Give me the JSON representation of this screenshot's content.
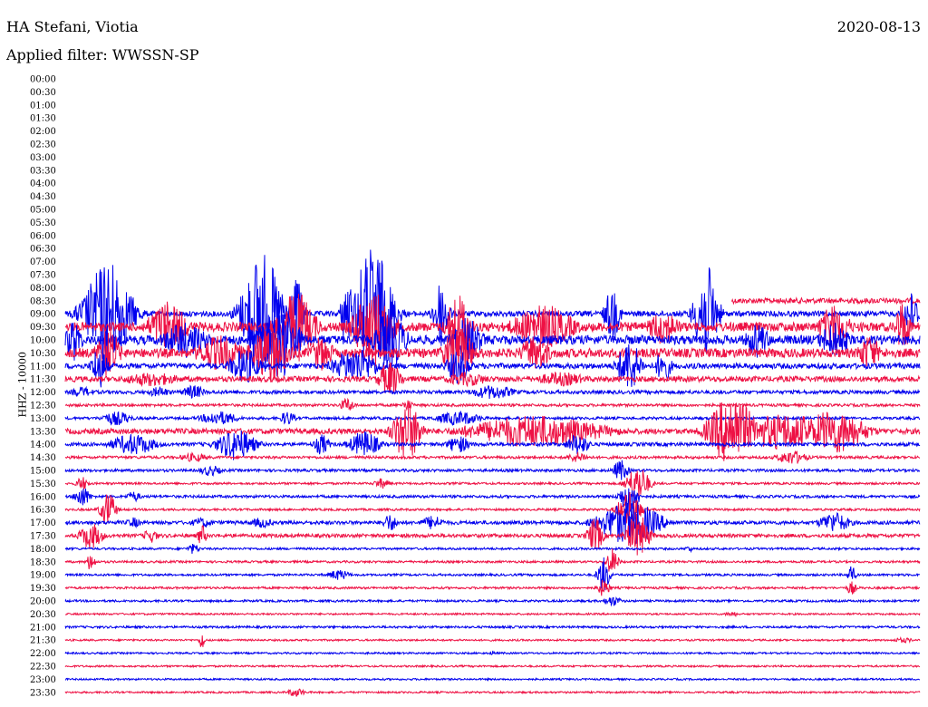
{
  "header": {
    "station": "HA Stefani, Viotia",
    "filter": "Applied filter: WWSSN-SP",
    "date": "2020-08-13"
  },
  "chart_data": {
    "type": "line",
    "title": "HA Stefani, Viotia",
    "subtitle": "Applied filter: WWSSN-SP",
    "date": "2020-08-13",
    "ylabel": "HHZ - 10000",
    "trace_colors": [
      "#0000ee",
      "#ee1144"
    ],
    "rows": [
      {
        "label": "00:00",
        "active": false
      },
      {
        "label": "00:30",
        "active": false
      },
      {
        "label": "01:00",
        "active": false
      },
      {
        "label": "01:30",
        "active": false
      },
      {
        "label": "02:00",
        "active": false
      },
      {
        "label": "02:30",
        "active": false
      },
      {
        "label": "03:00",
        "active": false
      },
      {
        "label": "03:30",
        "active": false
      },
      {
        "label": "04:00",
        "active": false
      },
      {
        "label": "04:30",
        "active": false
      },
      {
        "label": "05:00",
        "active": false
      },
      {
        "label": "05:30",
        "active": false
      },
      {
        "label": "06:00",
        "active": false
      },
      {
        "label": "06:30",
        "active": false
      },
      {
        "label": "07:00",
        "active": false
      },
      {
        "label": "07:30",
        "active": false
      },
      {
        "label": "08:00",
        "active": false
      },
      {
        "label": "08:30",
        "active": true,
        "start": 0.78,
        "noise": 3,
        "events": []
      },
      {
        "label": "09:00",
        "active": true,
        "start": 0,
        "noise": 3,
        "events": [
          [
            0.05,
            30,
            60
          ],
          [
            0.23,
            25,
            70
          ],
          [
            0.27,
            10,
            40
          ],
          [
            0.33,
            8,
            40
          ],
          [
            0.36,
            25,
            75
          ],
          [
            0.44,
            10,
            40
          ],
          [
            0.64,
            10,
            30
          ],
          [
            0.75,
            15,
            55
          ],
          [
            0.99,
            10,
            25
          ]
        ]
      },
      {
        "label": "09:30",
        "active": true,
        "start": 0,
        "noise": 5,
        "events": [
          [
            0.12,
            25,
            30
          ],
          [
            0.27,
            25,
            40
          ],
          [
            0.36,
            25,
            45
          ],
          [
            0.46,
            15,
            40
          ],
          [
            0.56,
            40,
            25
          ],
          [
            0.7,
            20,
            20
          ],
          [
            0.9,
            20,
            25
          ],
          [
            0.98,
            10,
            30
          ]
        ]
      },
      {
        "label": "10:00",
        "active": true,
        "start": 0,
        "noise": 5,
        "events": [
          [
            0.01,
            10,
            25
          ],
          [
            0.14,
            30,
            20
          ],
          [
            0.25,
            25,
            45
          ],
          [
            0.38,
            20,
            35
          ],
          [
            0.47,
            20,
            25
          ],
          [
            0.81,
            15,
            20
          ],
          [
            0.9,
            20,
            20
          ]
        ]
      },
      {
        "label": "10:30",
        "active": true,
        "start": 0,
        "noise": 5,
        "events": [
          [
            0.05,
            15,
            30
          ],
          [
            0.18,
            30,
            20
          ],
          [
            0.24,
            25,
            35
          ],
          [
            0.3,
            15,
            20
          ],
          [
            0.46,
            20,
            30
          ],
          [
            0.55,
            20,
            20
          ],
          [
            0.94,
            15,
            20
          ]
        ]
      },
      {
        "label": "11:00",
        "active": true,
        "start": 0,
        "noise": 3,
        "events": [
          [
            0.04,
            10,
            25
          ],
          [
            0.21,
            20,
            20
          ],
          [
            0.34,
            30,
            20
          ],
          [
            0.46,
            15,
            20
          ],
          [
            0.66,
            15,
            30
          ],
          [
            0.7,
            10,
            20
          ]
        ]
      },
      {
        "label": "11:30",
        "active": true,
        "start": 0,
        "noise": 3,
        "events": [
          [
            0.1,
            40,
            8
          ],
          [
            0.38,
            15,
            20
          ],
          [
            0.47,
            30,
            8
          ],
          [
            0.58,
            35,
            8
          ]
        ]
      },
      {
        "label": "12:00",
        "active": true,
        "start": 0,
        "noise": 2,
        "events": [
          [
            0.02,
            15,
            6
          ],
          [
            0.11,
            15,
            6
          ],
          [
            0.15,
            15,
            8
          ],
          [
            0.5,
            30,
            8
          ]
        ]
      },
      {
        "label": "12:30",
        "active": true,
        "start": 0,
        "noise": 1.5,
        "events": [
          [
            0.33,
            10,
            8
          ],
          [
            0.4,
            8,
            6
          ]
        ]
      },
      {
        "label": "13:00",
        "active": true,
        "start": 0,
        "noise": 1.5,
        "events": [
          [
            0.06,
            20,
            8
          ],
          [
            0.18,
            25,
            8
          ],
          [
            0.26,
            10,
            8
          ],
          [
            0.46,
            30,
            8
          ]
        ]
      },
      {
        "label": "13:30",
        "active": true,
        "start": 0,
        "noise": 3,
        "events": [
          [
            0.4,
            18,
            35
          ],
          [
            0.55,
            90,
            18
          ],
          [
            0.78,
            30,
            40
          ],
          [
            0.84,
            70,
            20
          ],
          [
            0.9,
            40,
            25
          ]
        ]
      },
      {
        "label": "14:00",
        "active": true,
        "start": 0,
        "noise": 2,
        "events": [
          [
            0.08,
            30,
            12
          ],
          [
            0.2,
            25,
            18
          ],
          [
            0.3,
            10,
            12
          ],
          [
            0.35,
            20,
            15
          ],
          [
            0.46,
            15,
            10
          ],
          [
            0.6,
            15,
            12
          ]
        ]
      },
      {
        "label": "14:30",
        "active": true,
        "start": 0,
        "noise": 1.5,
        "events": [
          [
            0.15,
            20,
            5
          ],
          [
            0.6,
            15,
            6
          ],
          [
            0.85,
            20,
            8
          ]
        ]
      },
      {
        "label": "15:00",
        "active": true,
        "start": 0,
        "noise": 1.5,
        "events": [
          [
            0.17,
            15,
            6
          ],
          [
            0.65,
            10,
            12
          ]
        ]
      },
      {
        "label": "15:30",
        "active": true,
        "start": 0,
        "noise": 1.2,
        "events": [
          [
            0.02,
            8,
            8
          ],
          [
            0.37,
            10,
            6
          ],
          [
            0.67,
            15,
            20
          ]
        ]
      },
      {
        "label": "16:00",
        "active": true,
        "start": 0,
        "noise": 1.5,
        "events": [
          [
            0.02,
            10,
            12
          ],
          [
            0.08,
            10,
            6
          ],
          [
            0.66,
            12,
            20
          ]
        ]
      },
      {
        "label": "16:30",
        "active": true,
        "start": 0,
        "noise": 1.2,
        "events": [
          [
            0.05,
            10,
            20
          ],
          [
            0.66,
            15,
            20
          ]
        ]
      },
      {
        "label": "17:00",
        "active": true,
        "start": 0,
        "noise": 2,
        "events": [
          [
            0.08,
            10,
            6
          ],
          [
            0.16,
            15,
            6
          ],
          [
            0.23,
            15,
            6
          ],
          [
            0.38,
            10,
            10
          ],
          [
            0.43,
            15,
            8
          ],
          [
            0.66,
            40,
            25
          ],
          [
            0.9,
            20,
            12
          ]
        ]
      },
      {
        "label": "17:30",
        "active": true,
        "start": 0,
        "noise": 2,
        "events": [
          [
            0.03,
            15,
            15
          ],
          [
            0.1,
            10,
            8
          ],
          [
            0.16,
            6,
            12
          ],
          [
            0.62,
            10,
            20
          ],
          [
            0.67,
            15,
            25
          ]
        ]
      },
      {
        "label": "18:00",
        "active": true,
        "start": 0,
        "noise": 1.2,
        "events": [
          [
            0.15,
            8,
            6
          ],
          [
            0.73,
            5,
            4
          ]
        ]
      },
      {
        "label": "18:30",
        "active": true,
        "start": 0,
        "noise": 1.2,
        "events": [
          [
            0.03,
            6,
            10
          ],
          [
            0.64,
            8,
            15
          ]
        ]
      },
      {
        "label": "19:00",
        "active": true,
        "start": 0,
        "noise": 1.2,
        "events": [
          [
            0.32,
            15,
            6
          ],
          [
            0.63,
            8,
            20
          ],
          [
            0.92,
            5,
            12
          ]
        ]
      },
      {
        "label": "19:30",
        "active": true,
        "start": 0,
        "noise": 1.2,
        "events": [
          [
            0.63,
            8,
            10
          ],
          [
            0.92,
            6,
            8
          ]
        ]
      },
      {
        "label": "20:00",
        "active": true,
        "start": 0,
        "noise": 1.2,
        "events": [
          [
            0.64,
            12,
            6
          ]
        ]
      },
      {
        "label": "20:30",
        "active": true,
        "start": 0,
        "noise": 1,
        "events": [
          [
            0.78,
            10,
            3
          ]
        ]
      },
      {
        "label": "21:00",
        "active": true,
        "start": 0,
        "noise": 1.2,
        "events": []
      },
      {
        "label": "21:30",
        "active": true,
        "start": 0,
        "noise": 1,
        "events": [
          [
            0.16,
            3,
            14
          ],
          [
            0.98,
            15,
            3
          ]
        ]
      },
      {
        "label": "22:00",
        "active": true,
        "start": 0,
        "noise": 1,
        "events": [
          [
            0.5,
            4,
            3
          ]
        ]
      },
      {
        "label": "22:30",
        "active": true,
        "start": 0,
        "noise": 1,
        "events": []
      },
      {
        "label": "23:00",
        "active": true,
        "start": 0,
        "noise": 1,
        "events": []
      },
      {
        "label": "23:30",
        "active": true,
        "start": 0,
        "noise": 1,
        "events": [
          [
            0.27,
            12,
            5
          ]
        ]
      }
    ]
  }
}
